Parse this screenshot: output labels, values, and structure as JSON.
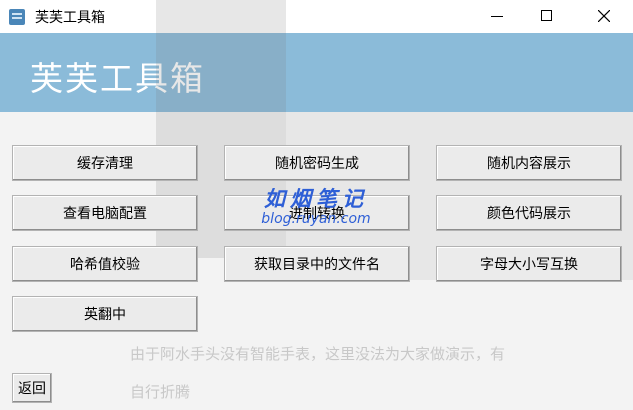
{
  "window": {
    "title": "芙芙工具箱"
  },
  "banner": {
    "title": "芙芙工具箱"
  },
  "buttons": [
    [
      "缓存清理",
      "随机密码生成",
      "随机内容展示"
    ],
    [
      "查看电脑配置",
      "进制转换",
      "颜色代码展示"
    ],
    [
      "哈希值校验",
      "获取目录中的文件名",
      "字母大小写互换"
    ],
    [
      "英翻中"
    ]
  ],
  "back_label": "返回",
  "background_text": {
    "line1": "由于阿水手头没有智能手表，这里没法为大家做演示，有",
    "line2": "自行折腾"
  },
  "watermark": {
    "name": "如烟笔记",
    "url": "blog.ruyan.com"
  },
  "colors": {
    "banner": "#8bbbd9",
    "button_bg": "#ebebeb",
    "watermark": "#2e5fd6"
  }
}
